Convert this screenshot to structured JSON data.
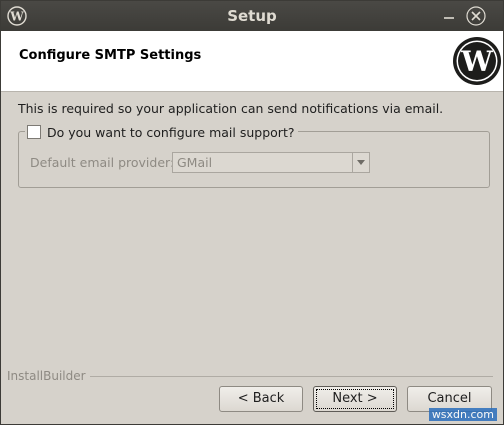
{
  "window": {
    "title": "Setup"
  },
  "header": {
    "heading": "Configure SMTP Settings"
  },
  "content": {
    "description": "This is required so your application can send notifications via email.",
    "mail_support_checkbox_label": "Do you want to configure mail support?",
    "mail_support_checked": false,
    "provider_label": "Default email provider:",
    "provider_value": "GMail"
  },
  "footer": {
    "brand": "InstallBuilder",
    "back_label": "< Back",
    "next_label": "Next >",
    "cancel_label": "Cancel"
  },
  "watermark": "wsxdn.com",
  "icons": [
    "wordpress-logo-icon",
    "minimize-icon",
    "close-icon",
    "chevron-down-icon"
  ],
  "colors": {
    "titlebar": "#3c3b37",
    "window_bg": "#d6d2cb",
    "header_bg": "#ffffff"
  }
}
